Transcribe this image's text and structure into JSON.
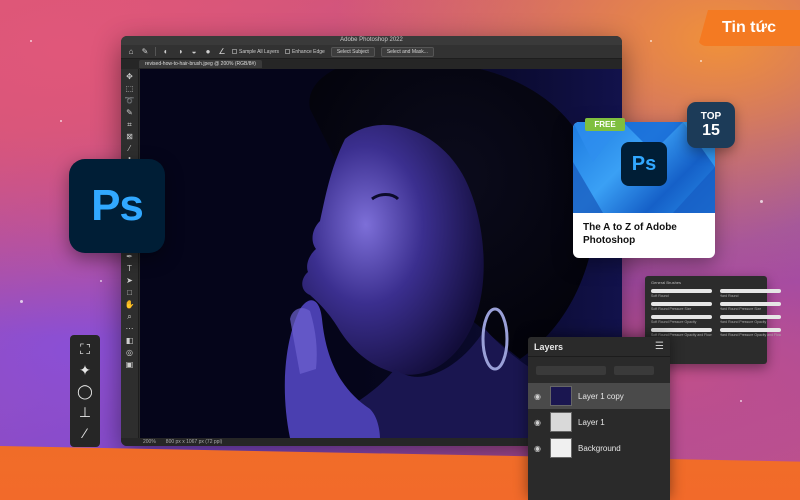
{
  "badge": {
    "label": "Tin tức"
  },
  "window": {
    "title": "Adobe Photoshop 2022",
    "options": {
      "sample_all_layers": "Sample All Layers",
      "enhance_edge": "Enhance Edge",
      "select_subject": "Select Subject",
      "select_and_mask": "Select and Mask..."
    },
    "document_tab": "revised-how-to-hair-brush.jpeg @ 200% (RGB/8#)",
    "status": {
      "zoom": "200%",
      "dimensions": "800 px x 1067 px (72 ppi)"
    }
  },
  "logo": {
    "text": "Ps"
  },
  "card": {
    "free_label": "FREE",
    "title": "The A to Z of Adobe Photoshop",
    "icon_text": "Ps"
  },
  "top_badge": {
    "line1": "TOP",
    "line2": "15"
  },
  "brushes": {
    "header": "General Brushes",
    "items": [
      {
        "label": "Soft Round"
      },
      {
        "label": "Hard Round"
      },
      {
        "label": "Soft Round Pressure Size"
      },
      {
        "label": "Hard Round Pressure Size"
      },
      {
        "label": "Soft Round Pressure Opacity"
      },
      {
        "label": "Hard Round Pressure Opacity"
      },
      {
        "label": "Soft Round Pressure Opacity and Flow"
      },
      {
        "label": "Hard Round Pressure Opacity and Flow"
      }
    ]
  },
  "layers": {
    "title": "Layers",
    "rows": [
      {
        "name": "Layer 1 copy"
      },
      {
        "name": "Layer 1"
      },
      {
        "name": "Background"
      }
    ]
  },
  "colors": {
    "accent_orange": "#f47a22",
    "ps_blue": "#31a8ff",
    "ps_navy": "#001e36",
    "free_green": "#7fbf3f"
  }
}
